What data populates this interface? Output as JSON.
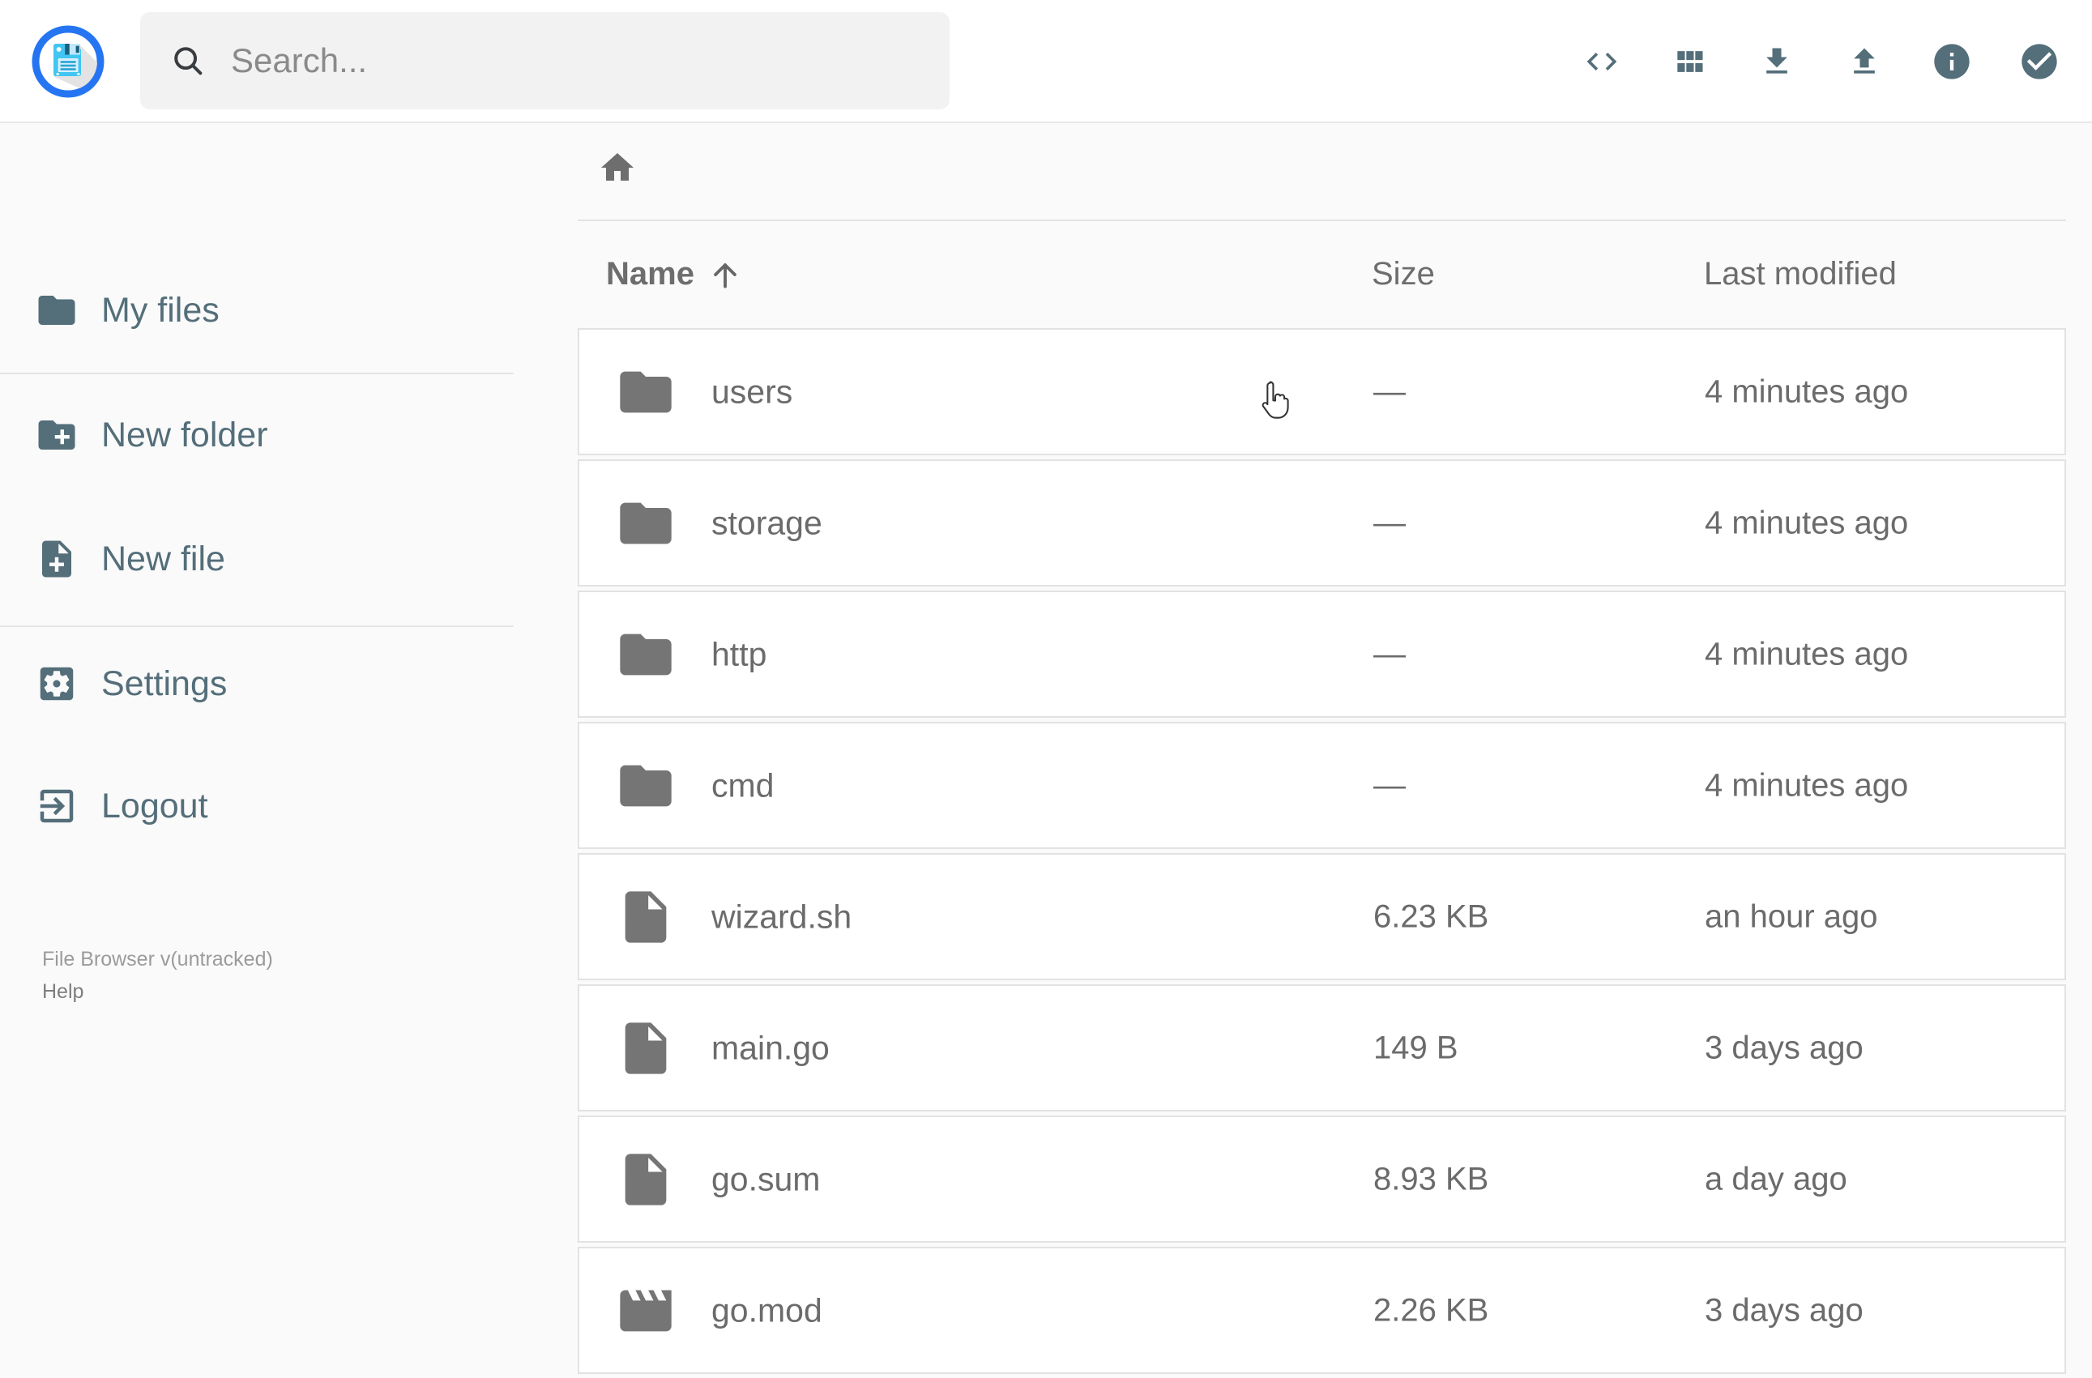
{
  "topbar": {
    "logo_icon": "floppy-disk-logo",
    "search": {
      "placeholder": "Search...",
      "icon": "search-icon"
    },
    "actions": [
      {
        "name": "code-button",
        "icon": "code-icon"
      },
      {
        "name": "grid-view-button",
        "icon": "grid-view-icon"
      },
      {
        "name": "download-button",
        "icon": "download-icon"
      },
      {
        "name": "upload-button",
        "icon": "upload-icon"
      },
      {
        "name": "info-button",
        "icon": "info-icon"
      },
      {
        "name": "select-multiple-button",
        "icon": "check-circle-icon"
      }
    ]
  },
  "sidebar": {
    "items": [
      {
        "name": "sidebar-item-my-files",
        "icon": "folder-icon",
        "label": "My files"
      },
      {
        "name": "sidebar-item-new-folder",
        "icon": "new-folder-icon",
        "label": "New folder"
      },
      {
        "name": "sidebar-item-new-file",
        "icon": "new-file-icon",
        "label": "New file"
      },
      {
        "name": "sidebar-item-settings",
        "icon": "settings-icon",
        "label": "Settings"
      },
      {
        "name": "sidebar-item-logout",
        "icon": "logout-icon",
        "label": "Logout"
      }
    ],
    "footer": {
      "version": "File Browser v(untracked)",
      "help": "Help"
    }
  },
  "breadcrumb": {
    "home_icon": "home-icon"
  },
  "listing": {
    "headers": {
      "name": "Name",
      "size": "Size",
      "modified": "Last modified",
      "sort_icon": "arrow-up-icon"
    },
    "rows": [
      {
        "icon": "folder-icon",
        "name": "users",
        "size": "—",
        "modified": "4 minutes ago"
      },
      {
        "icon": "folder-icon",
        "name": "storage",
        "size": "—",
        "modified": "4 minutes ago"
      },
      {
        "icon": "folder-icon",
        "name": "http",
        "size": "—",
        "modified": "4 minutes ago"
      },
      {
        "icon": "folder-icon",
        "name": "cmd",
        "size": "—",
        "modified": "4 minutes ago"
      },
      {
        "icon": "file-icon",
        "name": "wizard.sh",
        "size": "6.23 KB",
        "modified": "an hour ago"
      },
      {
        "icon": "file-icon",
        "name": "main.go",
        "size": "149 B",
        "modified": "3 days ago"
      },
      {
        "icon": "file-icon",
        "name": "go.sum",
        "size": "8.93 KB",
        "modified": "a day ago"
      },
      {
        "icon": "movie-icon",
        "name": "go.mod",
        "size": "2.26 KB",
        "modified": "3 days ago"
      }
    ]
  },
  "cursor": {
    "icon": "hand-cursor"
  },
  "colors": {
    "accent_blue": "#2575f3",
    "icon_slate": "#546e7a",
    "listing_gray": "#6b6b6b",
    "page_background": "#fafafa",
    "row_background": "#ffffff",
    "border": "#e2e2e2",
    "search_background": "#f2f2f2",
    "logo_floppy": "#41c5f3"
  }
}
